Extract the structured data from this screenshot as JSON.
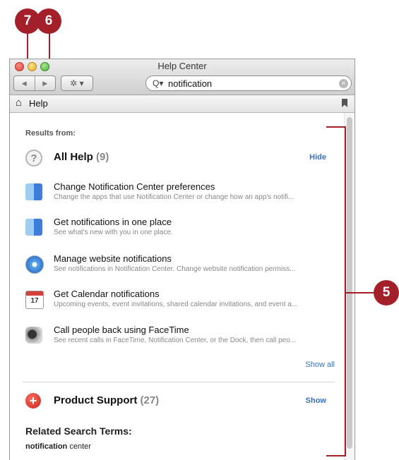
{
  "callouts": {
    "c7": "7",
    "c6": "6",
    "c5": "5"
  },
  "window": {
    "title": "Help Center"
  },
  "toolbar": {
    "back": "◀",
    "forward": "▶",
    "gear": "✲ ▾"
  },
  "search": {
    "icon": "Q▾",
    "value": "notification",
    "clear": "×"
  },
  "breadcrumb": {
    "home_icon": "⌂",
    "label": "Help"
  },
  "results": {
    "header": "Results from:",
    "all_help": {
      "title": "All Help",
      "count": "(9)",
      "link": "Hide"
    },
    "items": [
      {
        "title": "Change Notification Center preferences",
        "desc": "Change the apps that use Notification Center or change how an app's notifi...",
        "icon": "finder-icon"
      },
      {
        "title": "Get notifications in one place",
        "desc": "See what's new with you in one place.",
        "icon": "finder-icon"
      },
      {
        "title": "Manage website notifications",
        "desc": "See notifications in Notification Center. Change website notification permiss...",
        "icon": "safari-icon"
      },
      {
        "title": "Get Calendar notifications",
        "desc": "Upcoming events, event invitations, shared calendar invitations, and event a...",
        "icon": "calendar-icon",
        "icon_text": "17"
      },
      {
        "title": "Call people back using FaceTime",
        "desc": "See recent calls in FaceTime, Notification Center, or the Dock, then call peo...",
        "icon": "facetime-icon"
      }
    ],
    "show_all": "Show all",
    "product_support": {
      "title": "Product Support",
      "count": "(27)",
      "link": "Show"
    },
    "related_header": "Related Search Terms:",
    "related_term_bold": "notification",
    "related_term_rest": " center"
  },
  "colors": {
    "callout": "#a31f2a",
    "link": "#3a6fb5"
  }
}
